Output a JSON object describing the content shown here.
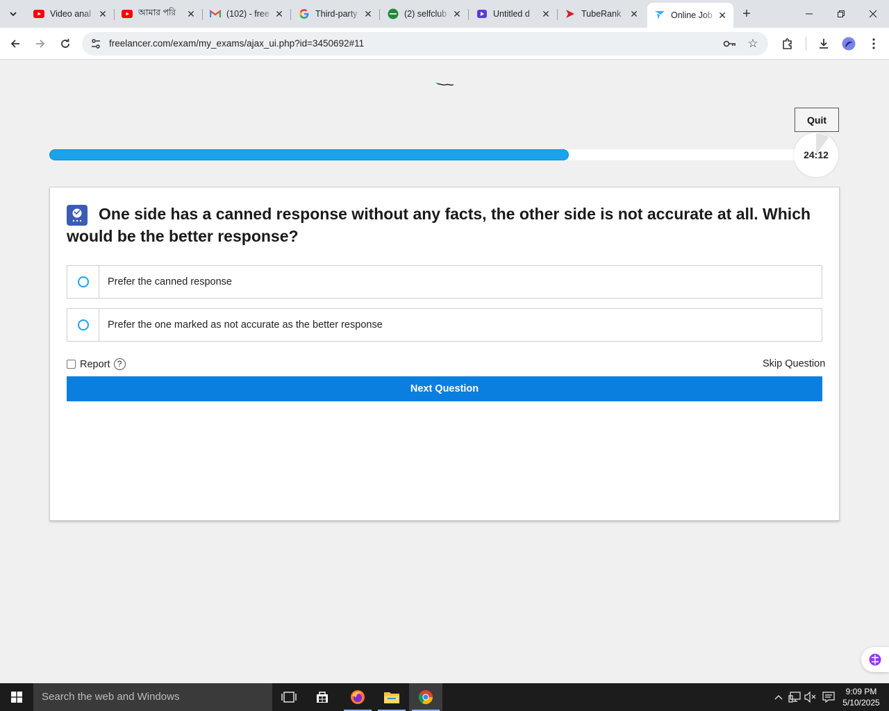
{
  "browser": {
    "tabs": [
      {
        "title": "Video anal",
        "icon": "youtube-icon"
      },
      {
        "title": "আমার পরি",
        "icon": "youtube-icon"
      },
      {
        "title": "(102) - free",
        "icon": "gmail-icon"
      },
      {
        "title": "Third-party",
        "icon": "google-icon"
      },
      {
        "title": "(2) selfclub",
        "icon": "selfclub-icon"
      },
      {
        "title": "Untitled d",
        "icon": "clipchamp-icon"
      },
      {
        "title": "TubeRank",
        "icon": "tuberank-icon"
      },
      {
        "title": "Online Job",
        "icon": "freelancer-icon",
        "active": true
      }
    ],
    "close_glyph": "✕",
    "new_tab_glyph": "+",
    "url": "freelancer.com/exam/my_exams/ajax_ui.php?id=3450692#11"
  },
  "exam": {
    "quit_label": "Quit",
    "progress": 0.68,
    "timer": "24:12",
    "timer_remaining_fraction": 0.9,
    "question": "One side has a canned response without any facts, the other side is not accurate at all. Which would be the better response?",
    "options": [
      {
        "label": "Prefer the canned response"
      },
      {
        "label": "Prefer the one marked as not accurate as the better response"
      }
    ],
    "report_label": "Report",
    "help_glyph": "?",
    "skip_label": "Skip Question",
    "next_label": "Next Question"
  },
  "taskbar": {
    "search_placeholder": "Search the web and Windows",
    "time": "9:09 PM",
    "date": "5/10/2025"
  },
  "colors": {
    "progress": "#1aa3ea",
    "next_button": "#0a7fe0",
    "radio": "#1aa3ea"
  }
}
